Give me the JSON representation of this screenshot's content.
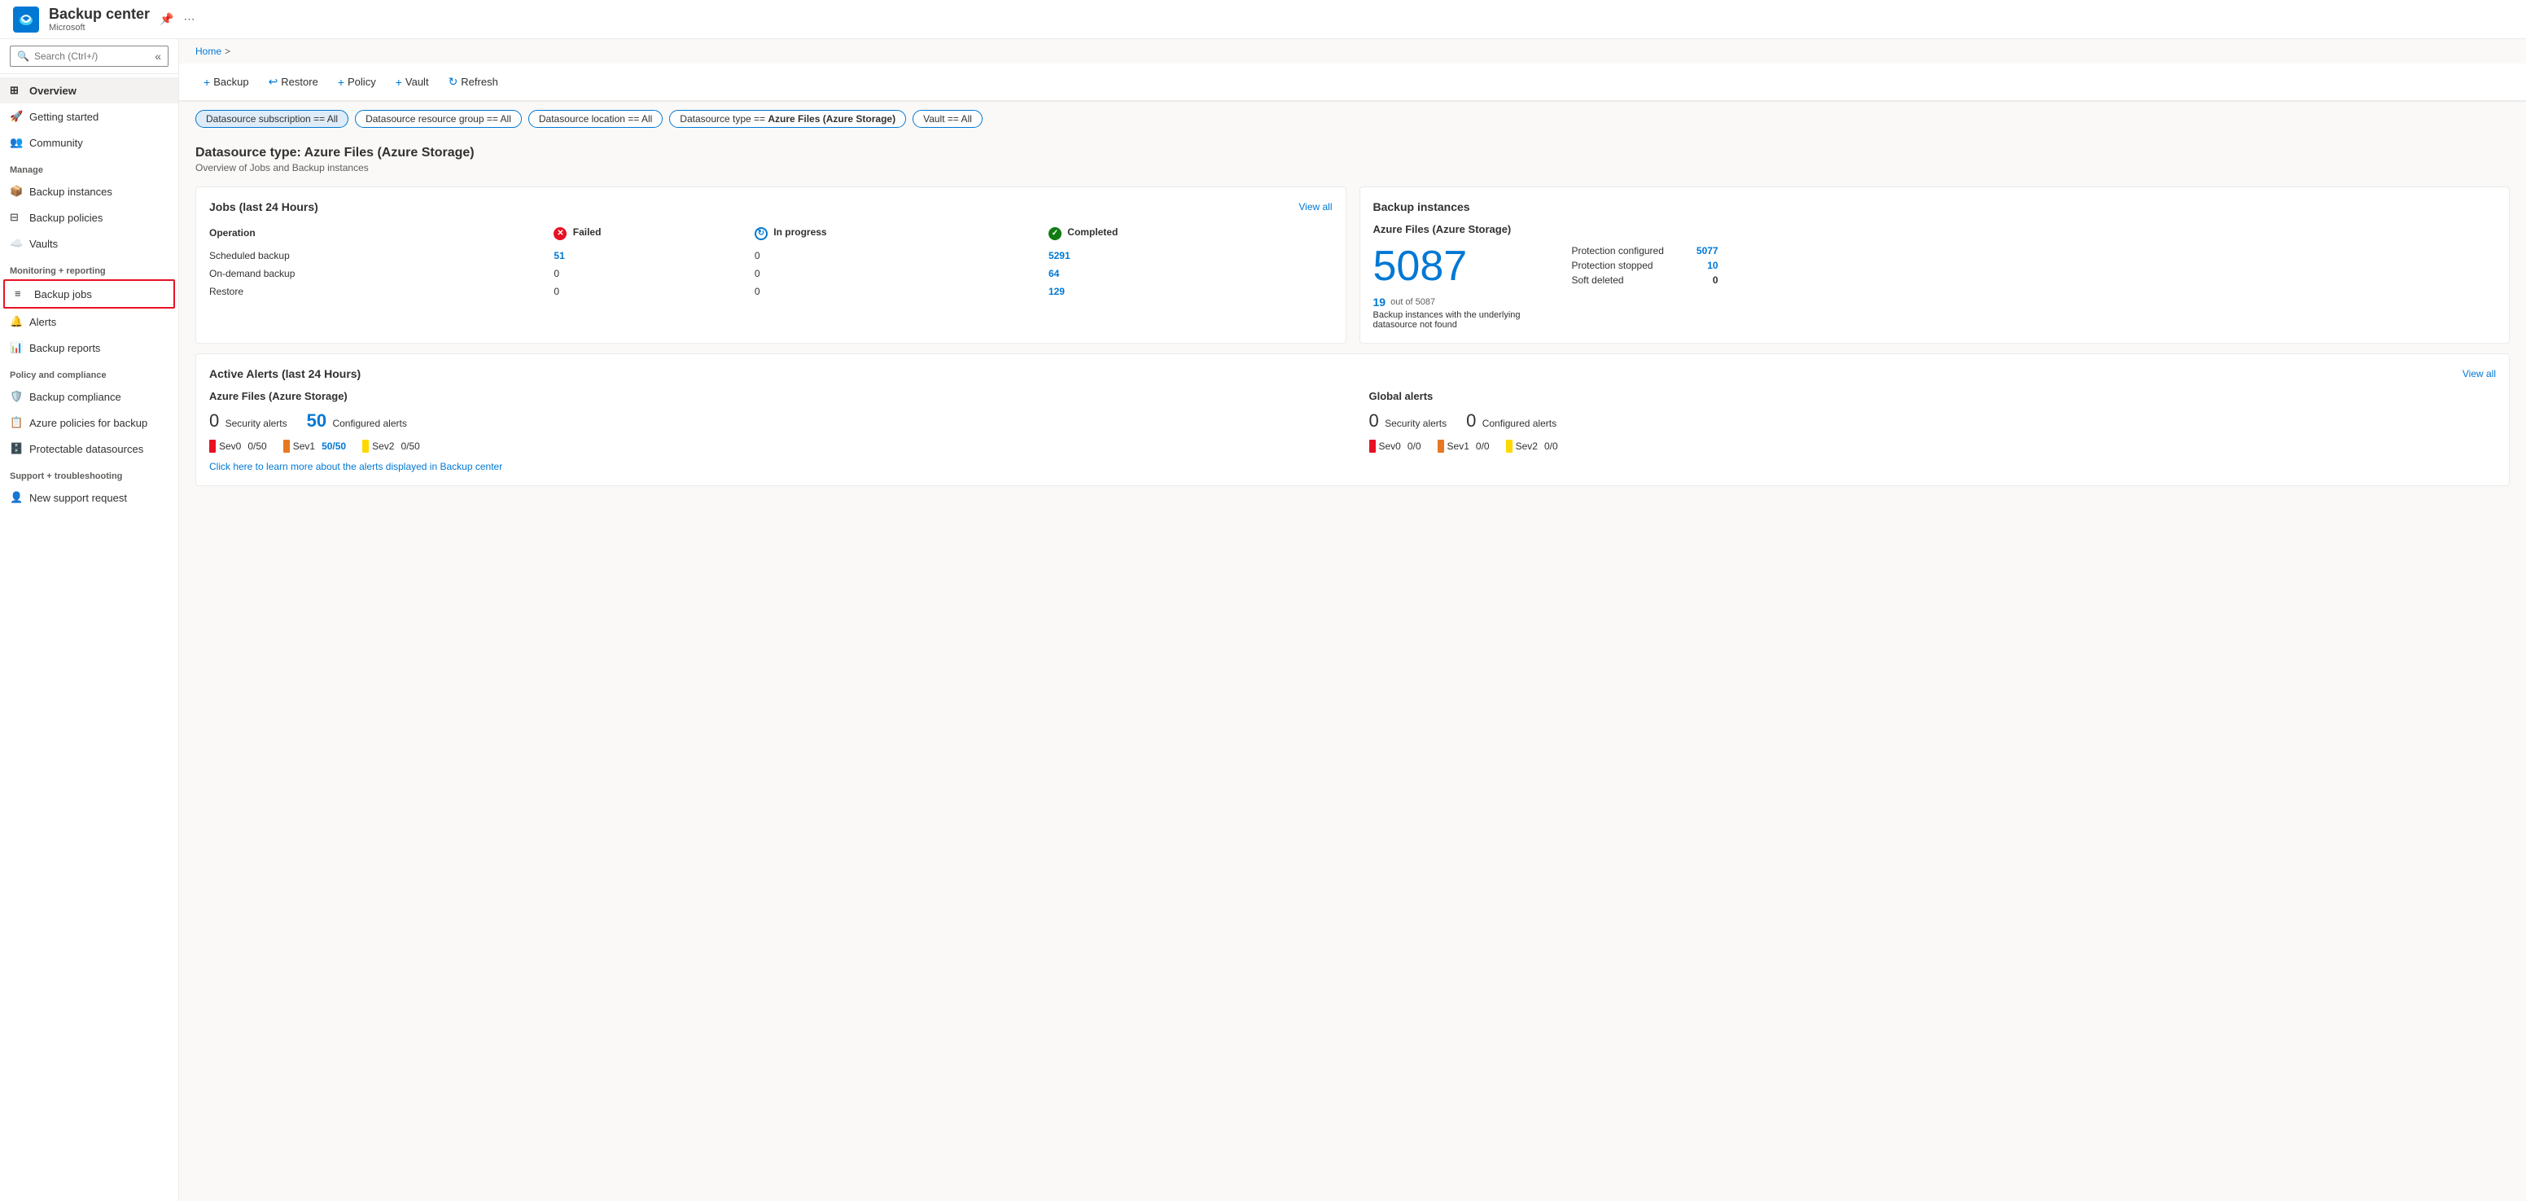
{
  "app": {
    "title": "Backup center",
    "subtitle": "Microsoft",
    "pin_label": "📌",
    "more_label": "⋯"
  },
  "search": {
    "placeholder": "Search (Ctrl+/)"
  },
  "breadcrumb": {
    "home": "Home",
    "sep": ">"
  },
  "sidebar": {
    "collapse_icon": "«",
    "nav": [
      {
        "id": "overview",
        "label": "Overview",
        "icon": "grid",
        "active": true
      },
      {
        "id": "getting-started",
        "label": "Getting started",
        "icon": "rocket"
      },
      {
        "id": "community",
        "label": "Community",
        "icon": "people"
      }
    ],
    "sections": [
      {
        "header": "Manage",
        "items": [
          {
            "id": "backup-instances",
            "label": "Backup instances",
            "icon": "box"
          },
          {
            "id": "backup-policies",
            "label": "Backup policies",
            "icon": "grid2"
          },
          {
            "id": "vaults",
            "label": "Vaults",
            "icon": "cloud"
          }
        ]
      },
      {
        "header": "Monitoring + reporting",
        "items": [
          {
            "id": "backup-jobs",
            "label": "Backup jobs",
            "icon": "list",
            "outlined": true
          },
          {
            "id": "alerts",
            "label": "Alerts",
            "icon": "bell"
          },
          {
            "id": "backup-reports",
            "label": "Backup reports",
            "icon": "chart"
          }
        ]
      },
      {
        "header": "Policy and compliance",
        "items": [
          {
            "id": "backup-compliance",
            "label": "Backup compliance",
            "icon": "shield"
          },
          {
            "id": "azure-policies",
            "label": "Azure policies for backup",
            "icon": "policy"
          },
          {
            "id": "protectable-datasources",
            "label": "Protectable datasources",
            "icon": "database"
          }
        ]
      },
      {
        "header": "Support + troubleshooting",
        "items": [
          {
            "id": "new-support-request",
            "label": "New support request",
            "icon": "person"
          }
        ]
      }
    ]
  },
  "toolbar": {
    "buttons": [
      {
        "id": "backup",
        "label": "Backup",
        "icon": "+"
      },
      {
        "id": "restore",
        "label": "Restore",
        "icon": "↩"
      },
      {
        "id": "policy",
        "label": "Policy",
        "icon": "+"
      },
      {
        "id": "vault",
        "label": "Vault",
        "icon": "+"
      },
      {
        "id": "refresh",
        "label": "Refresh",
        "icon": "↻"
      }
    ]
  },
  "filters": [
    {
      "id": "datasource-subscription",
      "label": "Datasource subscription == All",
      "active": true
    },
    {
      "id": "datasource-resource-group",
      "label": "Datasource resource group == All",
      "active": false
    },
    {
      "id": "datasource-location",
      "label": "Datasource location == All",
      "active": false
    },
    {
      "id": "datasource-type",
      "label": "Datasource type == Azure Files (Azure Storage)",
      "active": false
    },
    {
      "id": "vault",
      "label": "Vault == All",
      "active": false
    }
  ],
  "page": {
    "title": "Datasource type: Azure Files (Azure Storage)",
    "subtitle": "Overview of Jobs and Backup instances"
  },
  "jobs_card": {
    "title": "Jobs (last 24 Hours)",
    "view_all": "View all",
    "columns": {
      "operation": "Operation",
      "failed": "Failed",
      "in_progress": "In progress",
      "completed": "Completed"
    },
    "rows": [
      {
        "operation": "Scheduled backup",
        "failed": "51",
        "failed_link": true,
        "in_progress": "0",
        "completed": "5291",
        "completed_link": true
      },
      {
        "operation": "On-demand backup",
        "failed": "0",
        "in_progress": "0",
        "completed": "64",
        "completed_link": true
      },
      {
        "operation": "Restore",
        "failed": "0",
        "in_progress": "0",
        "completed": "129",
        "completed_link": true
      }
    ]
  },
  "backup_instances_card": {
    "title": "Backup instances",
    "section_title": "Azure Files (Azure Storage)",
    "big_number": "5087",
    "stats": [
      {
        "label": "Protection configured",
        "value": "5077",
        "link": true
      },
      {
        "label": "Protection stopped",
        "value": "10",
        "link": true
      },
      {
        "label": "Soft deleted",
        "value": "0",
        "link": false
      }
    ],
    "underlying_number": "19",
    "underlying_text": "out of 5087",
    "underlying_desc": "Backup instances with the underlying datasource not found"
  },
  "alerts_card": {
    "title": "Active Alerts (last 24 Hours)",
    "view_all": "View all",
    "azure_col": {
      "title": "Azure Files (Azure Storage)",
      "security_count": "0",
      "security_label": "Security alerts",
      "configured_count": "50",
      "configured_label": "Configured alerts",
      "sev_items": [
        {
          "level": "Sev0",
          "value": "0/50",
          "value_display": "0/50",
          "color": "red"
        },
        {
          "level": "Sev1",
          "value": "50/50",
          "value_display": "50/50",
          "is_link": true,
          "color": "orange"
        },
        {
          "level": "Sev2",
          "value": "0/50",
          "value_display": "0/50",
          "color": "yellow"
        }
      ]
    },
    "global_col": {
      "title": "Global alerts",
      "security_count": "0",
      "security_label": "Security alerts",
      "configured_count": "0",
      "configured_label": "Configured alerts",
      "sev_items": [
        {
          "level": "Sev0",
          "value": "0/0",
          "color": "red"
        },
        {
          "level": "Sev1",
          "value": "0/0",
          "color": "orange"
        },
        {
          "level": "Sev2",
          "value": "0/0",
          "color": "yellow"
        }
      ]
    },
    "link_text": "Click here to learn more about the alerts displayed in Backup center"
  }
}
